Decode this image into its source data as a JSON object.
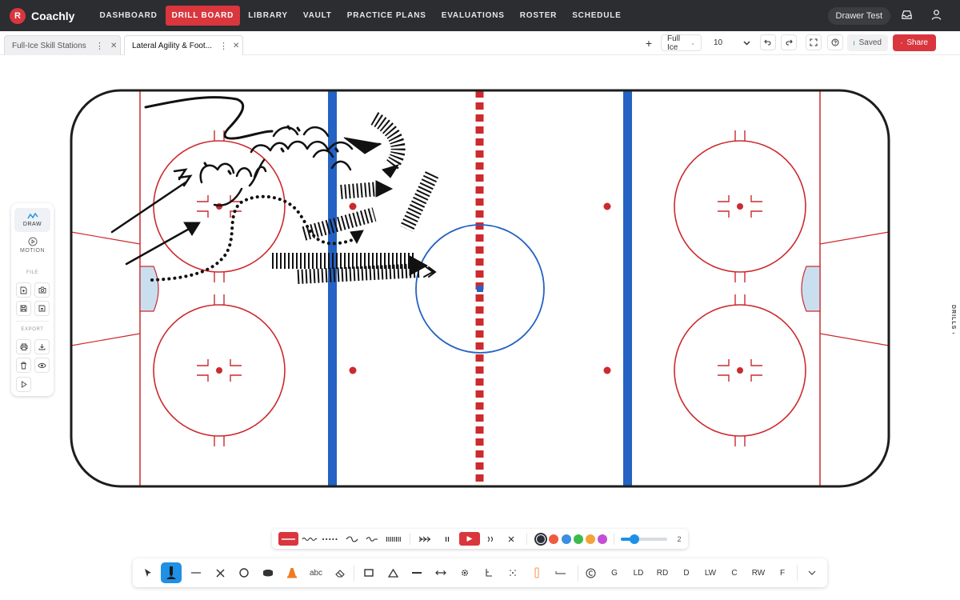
{
  "app": {
    "logo_letter": "R",
    "name": "Coachly"
  },
  "nav": {
    "items": [
      {
        "label": "DASHBOARD",
        "active": false
      },
      {
        "label": "DRILL BOARD",
        "active": true
      },
      {
        "label": "LIBRARY",
        "active": false
      },
      {
        "label": "VAULT",
        "active": false
      },
      {
        "label": "PRACTICE PLANS",
        "active": false
      },
      {
        "label": "EVALUATIONS",
        "active": false
      },
      {
        "label": "ROSTER",
        "active": false
      },
      {
        "label": "SCHEDULE",
        "active": false
      }
    ],
    "user_label": "Drawer Test"
  },
  "tabs": [
    {
      "label": "Full-Ice Skill Stations",
      "active": false
    },
    {
      "label": "Lateral Agility & Foot...",
      "active": true
    }
  ],
  "toolbar": {
    "add": "+",
    "rink_select": "Full Ice",
    "size_value": "10",
    "saved_label": "Saved",
    "share_label": "Share"
  },
  "left_panel": {
    "modes": [
      {
        "label": "DRAW",
        "icon": "draw-icon",
        "selected": true
      },
      {
        "label": "MOTION",
        "icon": "play-circle-icon",
        "selected": false
      }
    ],
    "file_label": "FILE",
    "export_label": "EXPORT"
  },
  "drills_tab": "DRILLS ›",
  "line_bar": {
    "colors": [
      "#2a2f3a",
      "#ef5b3f",
      "#3a8fe0",
      "#3cbb4d",
      "#f2a43a",
      "#c24fd8"
    ],
    "selected_color": "#2a2f3a",
    "width_value": "2",
    "width_fraction": 0.3
  },
  "main_bar": {
    "text_tool": "abc",
    "position_labels": [
      "G",
      "LD",
      "RD",
      "D",
      "LW",
      "C",
      "RW",
      "F"
    ]
  },
  "colors": {
    "accent": "#d9363e",
    "rink_red": "#cc2a2e",
    "rink_blue": "#2462c3"
  }
}
